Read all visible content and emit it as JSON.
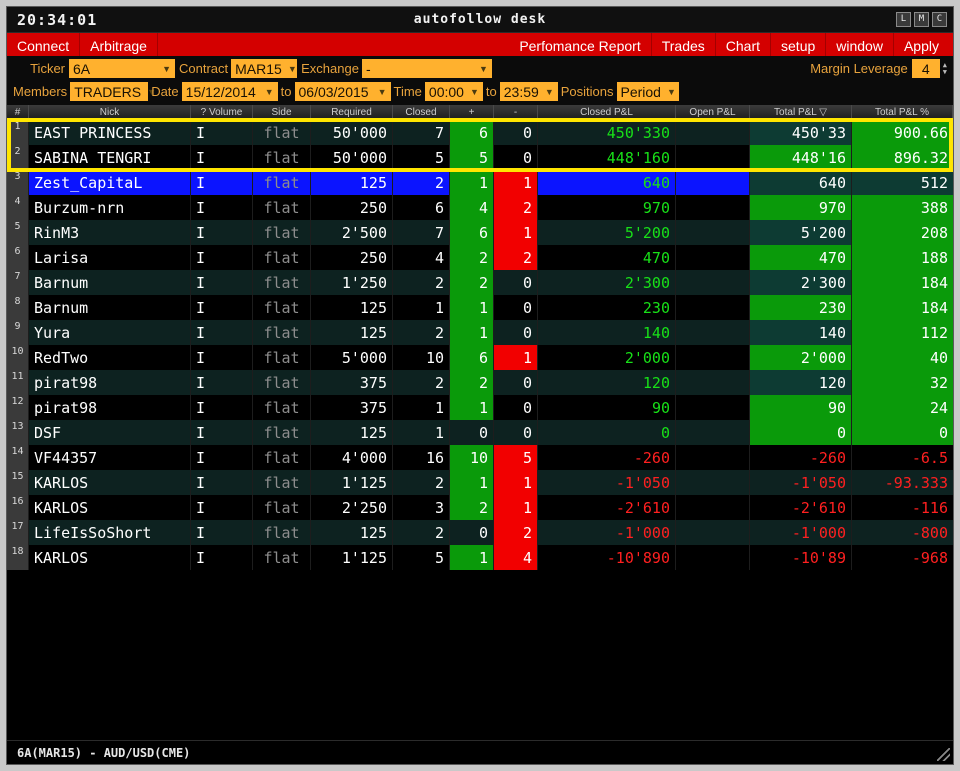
{
  "window": {
    "clock": "20:34:01",
    "title": "autofollow desk",
    "buttons": [
      {
        "name": "minimize-l",
        "label": "L"
      },
      {
        "name": "maximize-m",
        "label": "M"
      },
      {
        "name": "close-c",
        "label": "C"
      }
    ]
  },
  "menu": {
    "left_items": [
      {
        "name": "connect",
        "label": "Connect"
      },
      {
        "name": "arbitrage",
        "label": "Arbitrage"
      }
    ],
    "right_items": [
      {
        "name": "performance-report",
        "label": "Perfomance Report"
      },
      {
        "name": "trades",
        "label": "Trades"
      },
      {
        "name": "chart",
        "label": "Chart"
      },
      {
        "name": "setup",
        "label": "setup"
      },
      {
        "name": "window",
        "label": "window"
      },
      {
        "name": "apply",
        "label": "Apply"
      }
    ]
  },
  "filters": {
    "ticker_label": "Ticker",
    "ticker_value": "6A",
    "contract_label": "Contract",
    "contract_value": "MAR15",
    "exchange_label": "Exchange",
    "exchange_value": "-",
    "margin_label": "Margin Leverage",
    "margin_value": "4",
    "members_label": "Members",
    "members_value": "TRADERS",
    "date_label": "Date",
    "date_from": "15/12/2014",
    "to_label": "to",
    "date_to": "06/03/2015",
    "time_label": "Time",
    "time_from": "00:00",
    "to_label2": "to",
    "time_to": "23:59",
    "positions_label": "Positions",
    "positions_value": "Period"
  },
  "table": {
    "headers": [
      "#",
      "Nick",
      "? Volume",
      "Side",
      "Required",
      "Closed",
      "+",
      "-",
      "Closed P&L",
      "Open P&L",
      "Total P&L  ▽",
      "Total P&L  %"
    ],
    "rows": [
      {
        "idx": "1",
        "nick": "EAST PRINCESS",
        "vol": "I",
        "side": "flat",
        "required": "50'000",
        "closed": "7",
        "plus": "6",
        "minus": "0",
        "closed_pl": "450'330",
        "open_pl": "",
        "total_pl": "450'33",
        "total_pct": "900.66"
      },
      {
        "idx": "2",
        "nick": "SABINA TENGRI",
        "vol": "I",
        "side": "flat",
        "required": "50'000",
        "closed": "5",
        "plus": "5",
        "minus": "0",
        "closed_pl": "448'160",
        "open_pl": "",
        "total_pl": "448'16",
        "total_pct": "896.32"
      },
      {
        "idx": "3",
        "nick": "Zest_CapitaL",
        "vol": "I",
        "side": "flat",
        "required": "125",
        "closed": "2",
        "plus": "1",
        "minus": "1",
        "closed_pl": "640",
        "open_pl": "",
        "total_pl": "640",
        "total_pct": "512"
      },
      {
        "idx": "4",
        "nick": "Burzum-nrn",
        "vol": "I",
        "side": "flat",
        "required": "250",
        "closed": "6",
        "plus": "4",
        "minus": "2",
        "closed_pl": "970",
        "open_pl": "",
        "total_pl": "970",
        "total_pct": "388"
      },
      {
        "idx": "5",
        "nick": "RinM3",
        "vol": "I",
        "side": "flat",
        "required": "2'500",
        "closed": "7",
        "plus": "6",
        "minus": "1",
        "closed_pl": "5'200",
        "open_pl": "",
        "total_pl": "5'200",
        "total_pct": "208"
      },
      {
        "idx": "6",
        "nick": "Larisa",
        "vol": "I",
        "side": "flat",
        "required": "250",
        "closed": "4",
        "plus": "2",
        "minus": "2",
        "closed_pl": "470",
        "open_pl": "",
        "total_pl": "470",
        "total_pct": "188"
      },
      {
        "idx": "7",
        "nick": "Barnum",
        "vol": "I",
        "side": "flat",
        "required": "1'250",
        "closed": "2",
        "plus": "2",
        "minus": "0",
        "closed_pl": "2'300",
        "open_pl": "",
        "total_pl": "2'300",
        "total_pct": "184"
      },
      {
        "idx": "8",
        "nick": "Barnum",
        "vol": "I",
        "side": "flat",
        "required": "125",
        "closed": "1",
        "plus": "1",
        "minus": "0",
        "closed_pl": "230",
        "open_pl": "",
        "total_pl": "230",
        "total_pct": "184"
      },
      {
        "idx": "9",
        "nick": "Yura",
        "vol": "I",
        "side": "flat",
        "required": "125",
        "closed": "2",
        "plus": "1",
        "minus": "0",
        "closed_pl": "140",
        "open_pl": "",
        "total_pl": "140",
        "total_pct": "112"
      },
      {
        "idx": "10",
        "nick": "RedTwo",
        "vol": "I",
        "side": "flat",
        "required": "5'000",
        "closed": "10",
        "plus": "6",
        "minus": "1",
        "closed_pl": "2'000",
        "open_pl": "",
        "total_pl": "2'000",
        "total_pct": "40"
      },
      {
        "idx": "11",
        "nick": "pirat98",
        "vol": "I",
        "side": "flat",
        "required": "375",
        "closed": "2",
        "plus": "2",
        "minus": "0",
        "closed_pl": "120",
        "open_pl": "",
        "total_pl": "120",
        "total_pct": "32"
      },
      {
        "idx": "12",
        "nick": "pirat98",
        "vol": "I",
        "side": "flat",
        "required": "375",
        "closed": "1",
        "plus": "1",
        "minus": "0",
        "closed_pl": "90",
        "open_pl": "",
        "total_pl": "90",
        "total_pct": "24"
      },
      {
        "idx": "13",
        "nick": "DSF",
        "vol": "I",
        "side": "flat",
        "required": "125",
        "closed": "1",
        "plus": "0",
        "minus": "0",
        "closed_pl": "0",
        "open_pl": "",
        "total_pl": "0",
        "total_pct": "0"
      },
      {
        "idx": "14",
        "nick": "VF44357",
        "vol": "I",
        "side": "flat",
        "required": "4'000",
        "closed": "16",
        "plus": "10",
        "minus": "5",
        "closed_pl": "-260",
        "open_pl": "",
        "total_pl": "-260",
        "total_pct": "-6.5"
      },
      {
        "idx": "15",
        "nick": "KARLOS",
        "vol": "I",
        "side": "flat",
        "required": "1'125",
        "closed": "2",
        "plus": "1",
        "minus": "1",
        "closed_pl": "-1'050",
        "open_pl": "",
        "total_pl": "-1'050",
        "total_pct": "-93.333"
      },
      {
        "idx": "16",
        "nick": "KARLOS",
        "vol": "I",
        "side": "flat",
        "required": "2'250",
        "closed": "3",
        "plus": "2",
        "minus": "1",
        "closed_pl": "-2'610",
        "open_pl": "",
        "total_pl": "-2'610",
        "total_pct": "-116"
      },
      {
        "idx": "17",
        "nick": "LifeIsSoShort",
        "vol": "I",
        "side": "flat",
        "required": "125",
        "closed": "2",
        "plus": "0",
        "minus": "2",
        "closed_pl": "-1'000",
        "open_pl": "",
        "total_pl": "-1'000",
        "total_pct": "-800"
      },
      {
        "idx": "18",
        "nick": "KARLOS",
        "vol": "I",
        "side": "flat",
        "required": "1'125",
        "closed": "5",
        "plus": "1",
        "minus": "4",
        "closed_pl": "-10'890",
        "open_pl": "",
        "total_pl": "-10'89",
        "total_pct": "-968"
      }
    ]
  },
  "footer": {
    "status": "6A(MAR15) - AUD/USD(CME)"
  },
  "colors": {
    "menu_red": "#d40000",
    "field_amber": "#ffb12e",
    "highlight_yellow": "#ffe600",
    "profit_green": "#18e018",
    "loss_red": "#ff2020",
    "selected_blue": "#0b14ff"
  }
}
